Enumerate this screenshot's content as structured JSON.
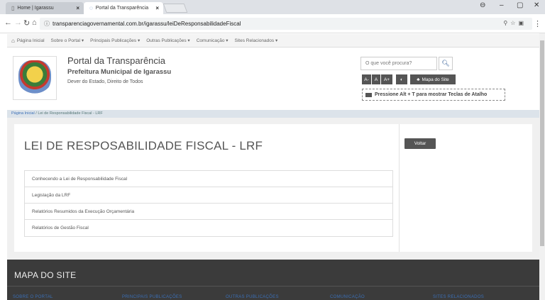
{
  "browser": {
    "tabs": [
      {
        "label": "Home | Igarassu"
      },
      {
        "label": "Portal da Transparência"
      }
    ],
    "close_glyph": "×",
    "url": "transparenciagovernamental.com.br/igarassu/leiDeResponsabilidadeFiscal"
  },
  "sitemenu": {
    "items": [
      "Página Inicial",
      "Sobre o Portal ▾",
      "Principais Publicações ▾",
      "Outras Publicações ▾",
      "Comunicação ▾",
      "Sites Relacionados ▾"
    ]
  },
  "header": {
    "title": "Portal da Transparência",
    "subtitle": "Prefeitura Municipal de Igarassu",
    "motto": "Dever do Estado, Direito de Todos",
    "search_placeholder": "O que você procura?",
    "acc_buttons": [
      "A-",
      "A",
      "A+",
      "◐",
      "Mapa do Site"
    ],
    "hotkeys": "Pressione Alt + T para mostrar Teclas de Atalho"
  },
  "breadcrumb": {
    "home": "Página Inicial",
    "sep": " / ",
    "current": "Lei de Responsabilidade Fiscal - LRF"
  },
  "main": {
    "title": "LEI DE RESPOSABILIDADE FISCAL - LRF",
    "back_label": "Voltar",
    "items": [
      "Conhecendo a Lei de Responsabilidade Fiscal",
      "Legislação da LRF",
      "Relatórios Resumidos da Execução Orçamentária",
      "Relatórios de Gestão Fiscal"
    ]
  },
  "footer": {
    "title": "MAPA DO SITE",
    "columns": [
      "SOBRE O PORTAL",
      "PRINCIPAIS PUBLICAÇÕES",
      "OUTRAS PUBLICAÇÕES",
      "COMUNICAÇÃO",
      "SITES RELACIONADOS"
    ]
  }
}
